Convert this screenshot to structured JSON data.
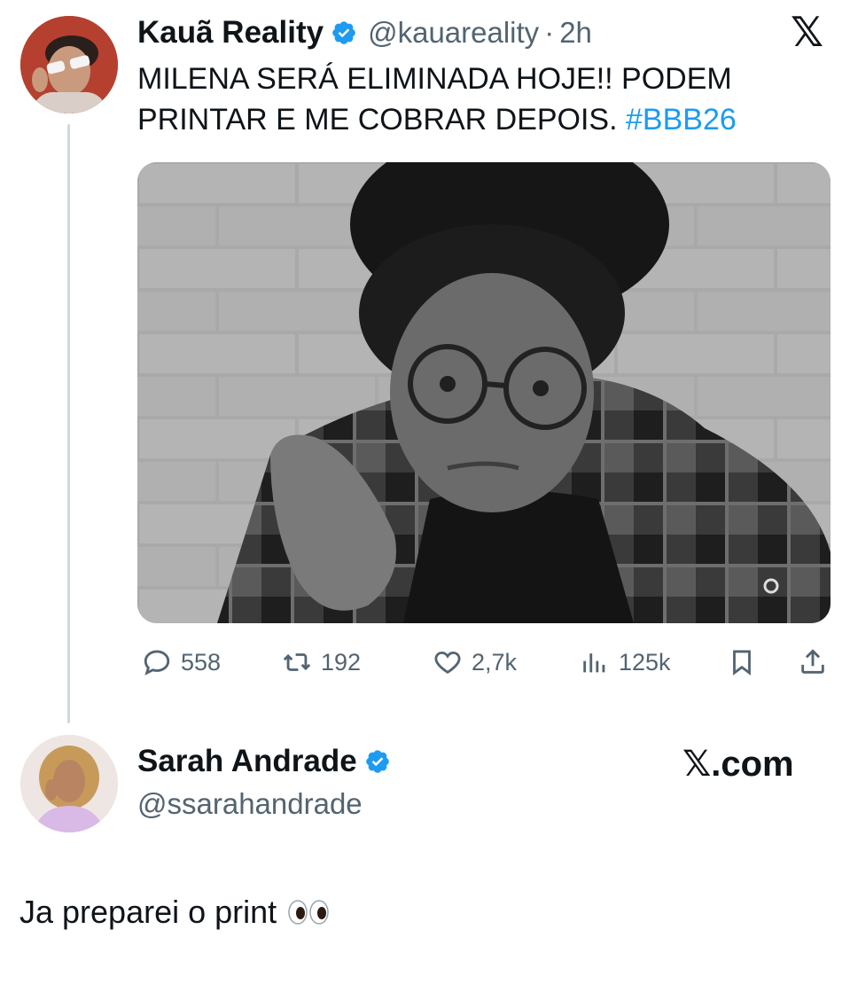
{
  "tweet": {
    "author_name": "Kauã Reality",
    "author_handle": "@kauareality",
    "separator": "·",
    "time": "2h",
    "text_line1": "MILENA SERÁ ELIMINADA HOJE!! PODEM",
    "text_line2": "PRINTAR E ME COBRAR DEPOIS.",
    "hashtag": "#BBB26",
    "stats": {
      "replies": "558",
      "retweets": "192",
      "likes": "2,7k",
      "views": "125k"
    },
    "brand_logo": "𝕏"
  },
  "reply_card": {
    "author_name": "Sarah Andrade",
    "author_handle": "@ssarahandrade",
    "site_label": "𝕏.com"
  },
  "comment": {
    "text": "Ja preparei o print"
  },
  "icons": {
    "verified": "verified-badge-icon",
    "reply": "speech-bubble-icon",
    "retweet": "retweet-arrows-icon",
    "like": "heart-icon",
    "views": "bar-chart-icon",
    "bookmark": "bookmark-icon",
    "share": "share-upload-icon",
    "eyes": "eyes-emoji-icon"
  },
  "colors": {
    "link": "#1d9bf0",
    "verified": "#1d9bf0",
    "muted": "#536471",
    "text": "#0f1419"
  }
}
